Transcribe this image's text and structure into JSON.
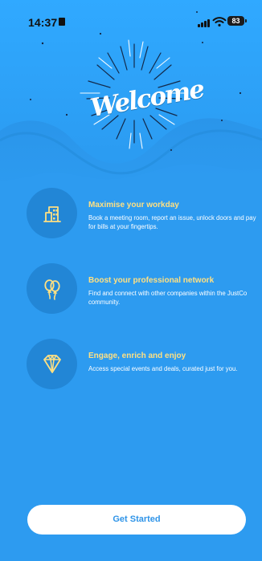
{
  "status_bar": {
    "time": "14:37",
    "battery_level": "83",
    "icons": [
      "lock-icon",
      "signal-icon",
      "wifi-icon",
      "battery-icon"
    ]
  },
  "welcome": {
    "title": "Welcome",
    "decorations": [
      "starburst-icon"
    ]
  },
  "features": [
    {
      "icon": "building-icon",
      "title": "Maximise your workday",
      "description": "Book a meeting room, report an issue, unlock doors and pay for bills at your fingertips."
    },
    {
      "icon": "balloons-icon",
      "title": "Boost your professional network",
      "description": "Find and connect with other companies within the JustCo community."
    },
    {
      "icon": "diamond-icon",
      "title": "Engage, enrich and enjoy",
      "description": "Access special events and deals, curated just for you."
    }
  ],
  "actions": {
    "get_started_label": "Get Started"
  },
  "colors": {
    "background": "#2d9bf0",
    "banner_top": "#31a8ff",
    "icon_circle": "#2286d6",
    "title_accent": "#ffe082",
    "button_background": "#ffffff",
    "button_text": "#2f94e8"
  }
}
